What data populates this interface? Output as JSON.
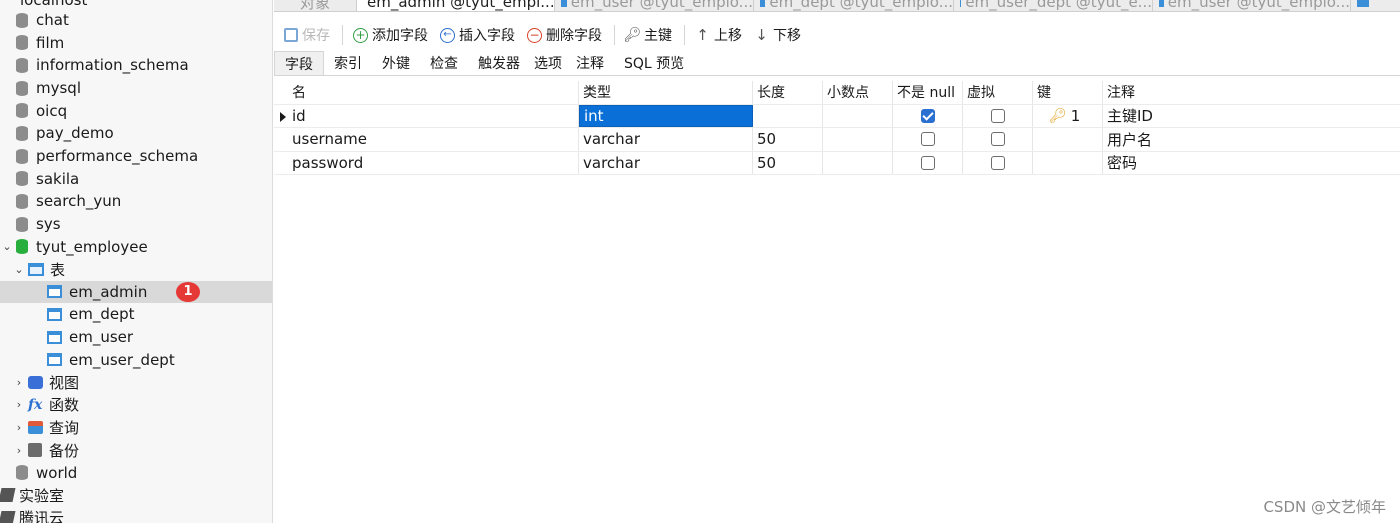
{
  "sidebar": {
    "connection": "localhost",
    "databases": [
      "chat",
      "film",
      "information_schema",
      "mysql",
      "oicq",
      "pay_demo",
      "performance_schema",
      "sakila",
      "search_yun",
      "sys"
    ],
    "open_db": "tyut_employee",
    "tables_folder": "表",
    "tables": [
      "em_admin",
      "em_dept",
      "em_user",
      "em_user_dept"
    ],
    "selected_table_badge": "1",
    "folders": [
      "视图",
      "函数",
      "查询",
      "备份"
    ],
    "after_db": "world",
    "groups": [
      "实验室",
      "腾讯云"
    ]
  },
  "tabs": [
    {
      "label": "对象"
    },
    {
      "label": "em_admin @tyut_empl..."
    },
    {
      "label": "em_user @tyut_emplo..."
    },
    {
      "label": "em_dept @tyut_emplo..."
    },
    {
      "label": "em_user_dept @tyut_e..."
    },
    {
      "label": "em_user @tyut_emplo..."
    }
  ],
  "toolbar": {
    "save": "保存",
    "add_field": "添加字段",
    "insert_field": "插入字段",
    "delete_field": "删除字段",
    "primary_key": "主键",
    "move_up": "上移",
    "move_down": "下移"
  },
  "subtabs": [
    "字段",
    "索引",
    "外键",
    "检查",
    "触发器",
    "选项",
    "注释",
    "SQL 预览"
  ],
  "grid": {
    "columns": [
      "名",
      "类型",
      "长度",
      "小数点",
      "不是 null",
      "虚拟",
      "键",
      "注释"
    ],
    "rows": [
      {
        "name": "id",
        "type": "int",
        "length": "",
        "decimals": "",
        "not_null": true,
        "virtual": false,
        "key": "1",
        "comment": "主键ID"
      },
      {
        "name": "username",
        "type": "varchar",
        "length": "50",
        "decimals": "",
        "not_null": false,
        "virtual": false,
        "key": "",
        "comment": "用户名"
      },
      {
        "name": "password",
        "type": "varchar",
        "length": "50",
        "decimals": "",
        "not_null": false,
        "virtual": false,
        "key": "",
        "comment": "密码"
      }
    ]
  },
  "watermark": "CSDN @文艺倾年",
  "colors": {
    "selection": "#0a6fd6",
    "db_open": "#27ae3d",
    "badge": "#e53935"
  }
}
